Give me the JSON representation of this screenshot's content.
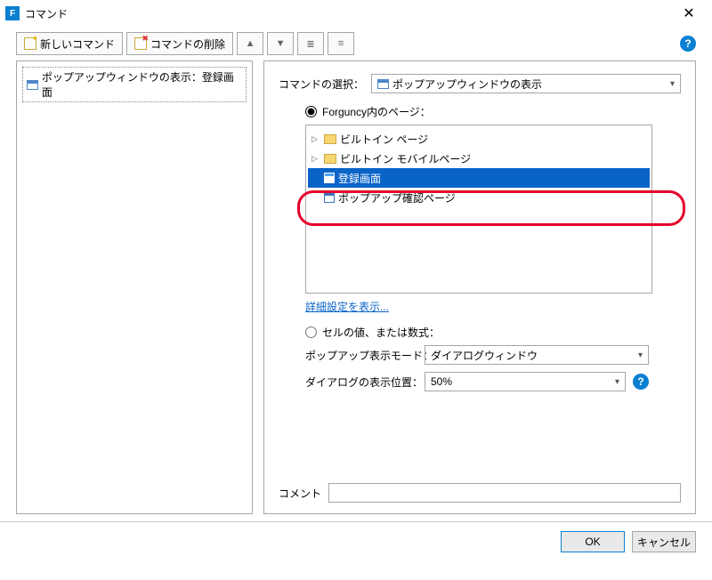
{
  "window": {
    "title": "コマンド"
  },
  "toolbar": {
    "new_command": "新しいコマンド",
    "delete_command": "コマンドの削除"
  },
  "left": {
    "item_label": "ポップアップウィンドウの表示：登録画面"
  },
  "right": {
    "select_label": "コマンドの選択：",
    "select_value": "ポップアップウィンドウの表示",
    "radio_page_label": "Forguncy内のページ：",
    "tree": {
      "items": [
        {
          "kind": "folder",
          "label": "ビルトイン ページ",
          "selected": false
        },
        {
          "kind": "folder",
          "label": "ビルトイン モバイルページ",
          "selected": false
        },
        {
          "kind": "page",
          "label": "登録画面",
          "selected": true
        },
        {
          "kind": "page",
          "label": "ポップアップ確認ページ",
          "selected": false
        }
      ]
    },
    "detail_link": "詳細設定を表示...",
    "radio_value_label": "セルの値、または数式：",
    "popup_mode_label": "ポップアップ表示モード：",
    "popup_mode_value": "ダイアログウィンドウ",
    "dialog_pos_label": "ダイアログの表示位置：",
    "dialog_pos_value": "50%",
    "comment_label": "コメント",
    "comment_value": ""
  },
  "footer": {
    "ok": "OK",
    "cancel": "キャンセル"
  }
}
